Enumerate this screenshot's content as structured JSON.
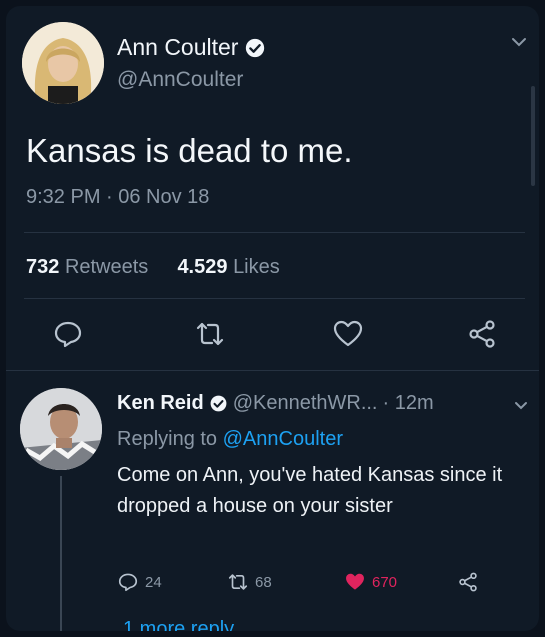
{
  "main_tweet": {
    "author_name": "Ann Coulter",
    "handle": "@AnnCoulter",
    "text": "Kansas is dead to me.",
    "timestamp": "9:32 PM · 06 Nov 18",
    "retweets_count": "732",
    "retweets_label": "Retweets",
    "likes_count": "4.529",
    "likes_label": "Likes"
  },
  "reply": {
    "author_name": "Ken Reid",
    "handle": "@KennethWR...",
    "time": "· 12m",
    "replying_prefix": "Replying to",
    "replying_handle": "@AnnCoulter",
    "text": "Come on Ann, you've hated Kansas since it dropped a house on your sister",
    "reply_count": "24",
    "retweet_count": "68",
    "like_count": "670"
  },
  "more_reply_label": "1 more reply",
  "colors": {
    "background": "#101a26",
    "accent": "#1da1f2",
    "like": "#e0245e",
    "muted": "#8b98a6"
  },
  "icons": {
    "verified": "verified-badge-icon",
    "chevron": "chevron-down-icon",
    "reply": "reply-icon",
    "retweet": "retweet-icon",
    "like": "heart-icon",
    "share": "share-icon"
  }
}
